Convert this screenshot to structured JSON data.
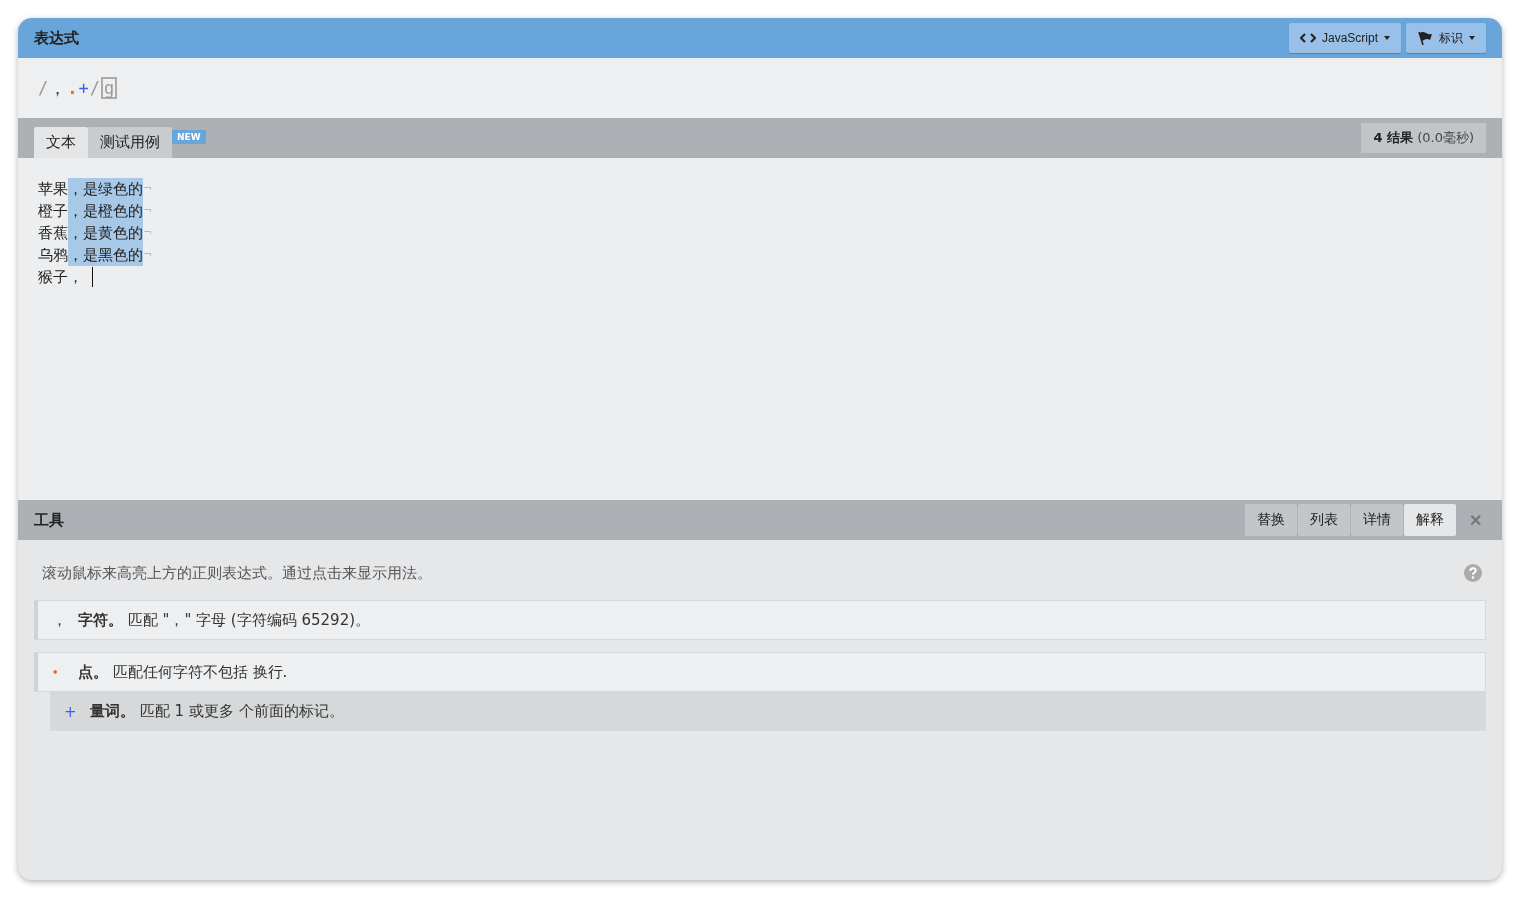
{
  "window": {
    "title": "表达式"
  },
  "header_buttons": [
    {
      "kind": "code",
      "label": "JavaScript"
    },
    {
      "kind": "flag",
      "label": "标识"
    }
  ],
  "expression": [
    {
      "kind": "delim",
      "text": "/"
    },
    {
      "kind": "char",
      "text": "，"
    },
    {
      "kind": "dot",
      "text": "."
    },
    {
      "kind": "quant",
      "text": "+"
    },
    {
      "kind": "delim",
      "text": "/"
    },
    {
      "kind": "flag",
      "text": "g"
    }
  ],
  "tabs": [
    {
      "label": "文本",
      "selected": true
    },
    {
      "label": "测试用例",
      "selected": false,
      "badge": "NEW"
    }
  ],
  "result": "**4 结果** (0.0毫秒)",
  "text_lines": [
    {
      "plain": "苹果",
      "match": "，是绿色的",
      "eol": "¬"
    },
    {
      "plain": "橙子",
      "match": "，是橙色的",
      "eol": "¬"
    },
    {
      "plain": "香蕉",
      "match": "，是黄色的",
      "eol": "¬"
    },
    {
      "plain": "乌鸦",
      "match": "，是黑色的",
      "eol": "¬"
    },
    {
      "plain": "猴子，",
      "caret": true
    }
  ],
  "tools": {
    "title": "工具",
    "tabs": [
      {
        "label": "替换",
        "selected": false
      },
      {
        "label": "列表",
        "selected": false
      },
      {
        "label": "详情",
        "selected": false
      },
      {
        "label": "解释",
        "selected": true
      }
    ],
    "close": "✕",
    "hint": "滚动鼠标来高亮上方的正则表达式。通过点击来显示用法。",
    "explanations": [
      {
        "kind": "char",
        "token": "，",
        "text": "**字符。** 匹配 \"，\" 字母 (字符编码 65292)。"
      },
      {
        "kind": "dot",
        "token": "•",
        "text": "**点。** 匹配任何字符不包括 换行.",
        "children": [
          {
            "kind": "quant",
            "token": "+",
            "text": "**量词。** 匹配 1 或更多 个前面的标记。"
          }
        ]
      }
    ]
  }
}
